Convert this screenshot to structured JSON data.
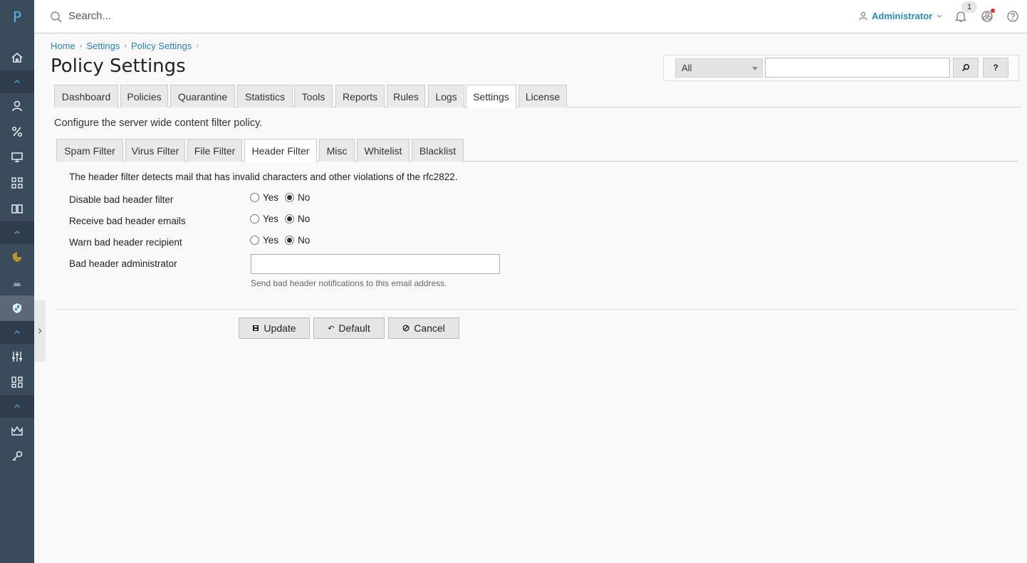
{
  "app": {
    "logo": "P"
  },
  "topbar": {
    "search_placeholder": "Search...",
    "user": "Administrator",
    "notification_count": "1"
  },
  "breadcrumb": [
    "Home",
    "Settings",
    "Policy Settings"
  ],
  "page_title": "Policy Settings",
  "search_panel": {
    "scope_selected": "All",
    "go_label": "",
    "help_label": "?"
  },
  "main_tabs": [
    "Dashboard",
    "Policies",
    "Quarantine",
    "Statistics",
    "Tools",
    "Reports",
    "Rules",
    "Logs",
    "Settings",
    "License"
  ],
  "main_tab_active": "Settings",
  "description": "Configure the server wide content filter policy.",
  "sub_tabs": [
    "Spam Filter",
    "Virus Filter",
    "File Filter",
    "Header Filter",
    "Misc",
    "Whitelist",
    "Blacklist"
  ],
  "sub_tab_active": "Header Filter",
  "form": {
    "description": "The header filter detects mail that has invalid characters and other violations of the rfc2822.",
    "rows": [
      {
        "label": "Disable bad header filter",
        "yes": "Yes",
        "no": "No",
        "value": "No"
      },
      {
        "label": "Receive bad header emails",
        "yes": "Yes",
        "no": "No",
        "value": "No"
      },
      {
        "label": "Warn bad header recipient",
        "yes": "Yes",
        "no": "No",
        "value": "No"
      }
    ],
    "admin_label": "Bad header administrator",
    "admin_value": "",
    "admin_hint": "Send bad header notifications to this email address."
  },
  "buttons": {
    "update": "Update",
    "default": "Default",
    "cancel": "Cancel"
  },
  "colors": {
    "sidebar": "#3c4b5c",
    "link": "#2a7fb0",
    "accent": "#5bb6e6"
  }
}
